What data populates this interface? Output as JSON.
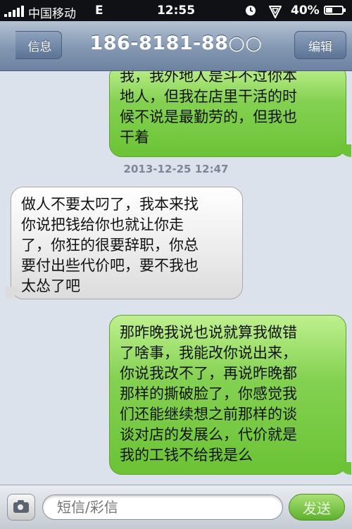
{
  "status_bar": {
    "carrier": "中国移动",
    "network": "E",
    "time": "12:55",
    "battery_percent": "40%",
    "battery_level": 0.4
  },
  "nav": {
    "back_label": "信息",
    "title": "186-8181-88○○",
    "edit_label": "编辑"
  },
  "messages": [
    {
      "direction": "outgoing",
      "text": "我，我外地人是斗不过你本\n地人，但我在店里干活的时\n候不说是最勤劳的，但我也\n干着"
    },
    {
      "direction": "timestamp",
      "text": "2013-12-25 12:47"
    },
    {
      "direction": "incoming",
      "text": "做人不要太叼了，我本来找\n你说把钱给你也就让你走\n了，你狂的很要辞职，你总\n要付出些代价吧，要不我也\n太怂了吧"
    },
    {
      "direction": "outgoing",
      "text": "那昨晚我说也说就算我做错\n了啥事，我能改你说出来，\n你说我改不了，再说昨晚都\n那样的撕破脸了，你感觉我\n们还能继续想之前那样的谈\n谈对店的发展么，代价就是\n我的工钱不给我是么"
    }
  ],
  "input_bar": {
    "placeholder": "短信/彩信",
    "send_label": "发送"
  },
  "colors": {
    "outgoing_bubble": "#84d152",
    "incoming_bubble": "#eeeeee",
    "nav_bar": "#8397b1"
  }
}
